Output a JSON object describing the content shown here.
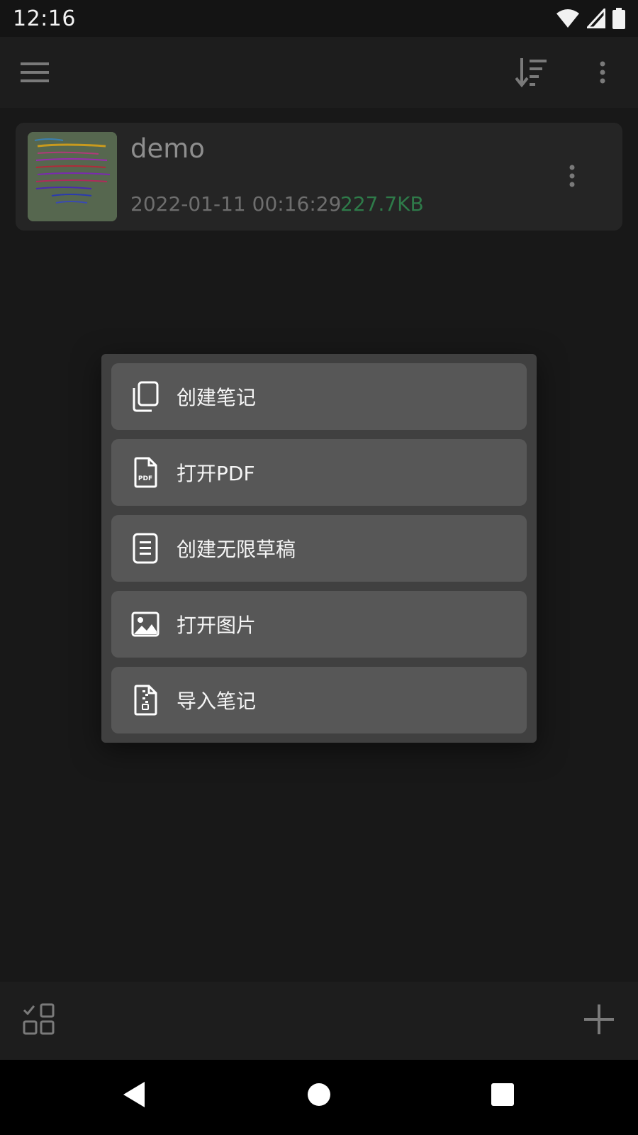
{
  "status_bar": {
    "time": "12:16",
    "icons": [
      "wifi-icon",
      "cell-signal-icon",
      "battery-icon"
    ]
  },
  "app_bar": {
    "icons": [
      "menu-icon",
      "sort-icon",
      "more-vert-icon"
    ]
  },
  "notes": [
    {
      "title": "demo",
      "date": "2022-01-11 00:16:29",
      "size": "227.7KB"
    }
  ],
  "popup_menu": {
    "items": [
      {
        "label": "创建笔记",
        "icon": "copy-pages-icon"
      },
      {
        "label": "打开PDF",
        "icon": "pdf-file-icon"
      },
      {
        "label": "创建无限草稿",
        "icon": "document-lines-icon"
      },
      {
        "label": "打开图片",
        "icon": "image-icon"
      },
      {
        "label": "导入笔记",
        "icon": "zip-file-icon"
      }
    ]
  },
  "bottom_bar": {
    "icons": [
      "select-grid-icon",
      "add-icon"
    ]
  },
  "nav_bar": {
    "icons": [
      "back-icon",
      "home-icon",
      "recents-icon"
    ]
  },
  "colors": {
    "background": "#181818",
    "menu_item": "#575757",
    "size_text": "#2e7a49"
  }
}
